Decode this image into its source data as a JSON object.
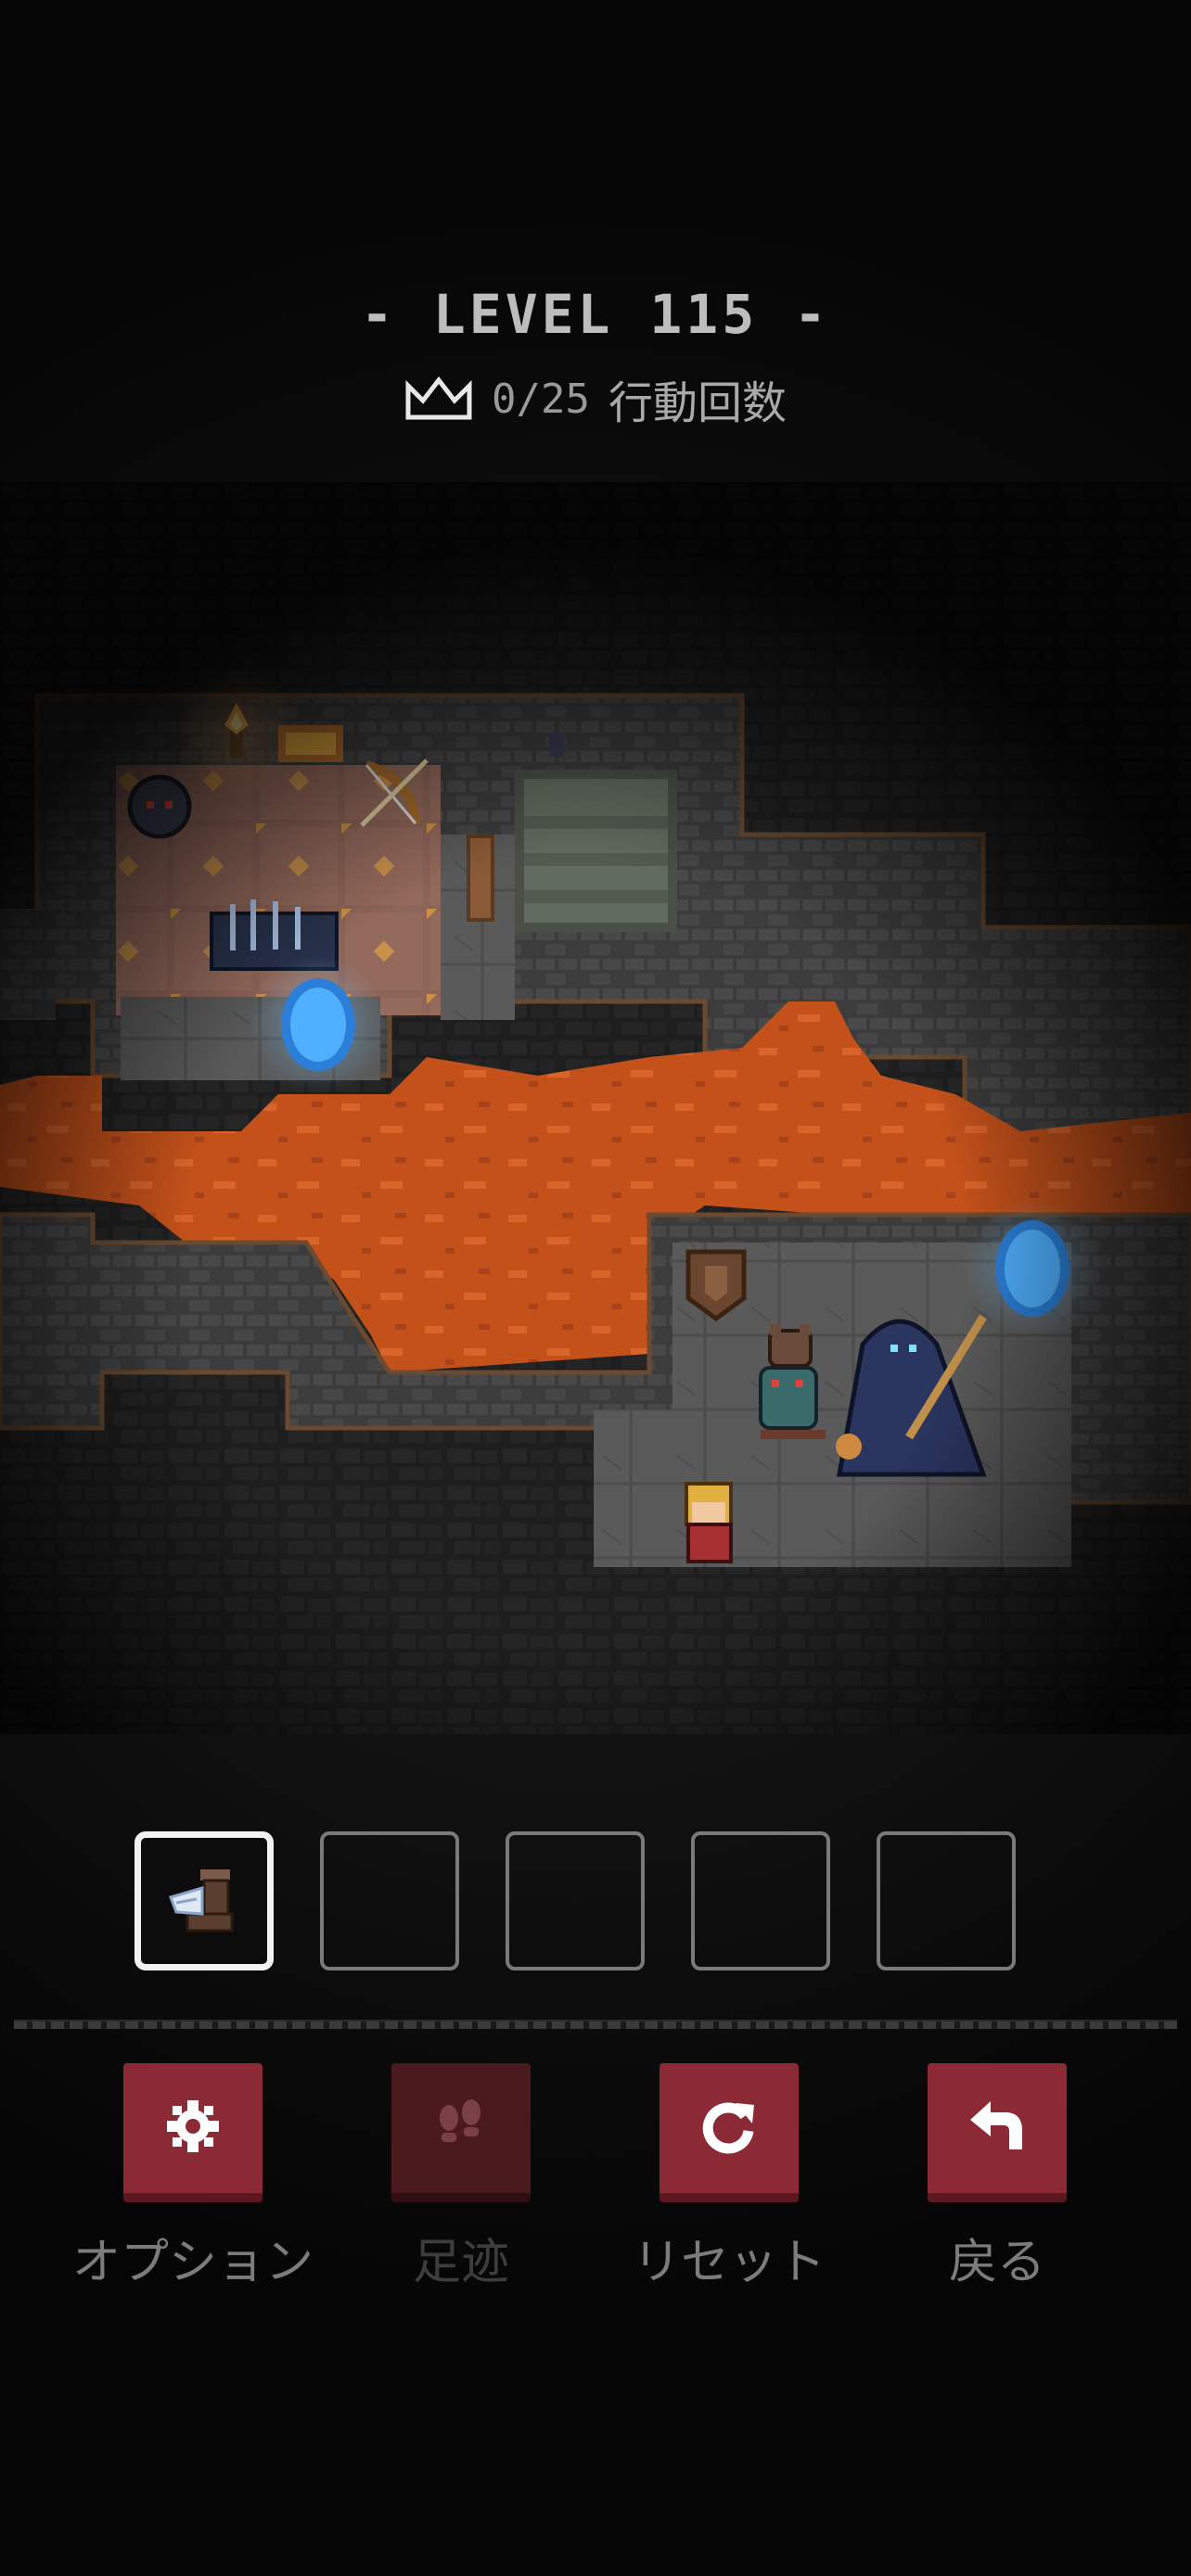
{
  "header": {
    "level_title": "- LEVEL 115 -",
    "moves_count": "0/25",
    "moves_label": "行動回数"
  },
  "inventory": {
    "selected_index": 0,
    "slots": [
      {
        "item": "winged-boots-icon",
        "empty": false
      },
      {
        "item": "",
        "empty": true
      },
      {
        "item": "",
        "empty": true
      },
      {
        "item": "",
        "empty": true
      },
      {
        "item": "",
        "empty": true
      }
    ]
  },
  "controls": {
    "options_label": "オプション",
    "footprints_label": "足迹",
    "reset_label": "リセット",
    "back_label": "戻る"
  },
  "colors": {
    "button": "#8b2a35",
    "button_disabled": "#4a1a1f",
    "lava": "#c8551c",
    "stone_floor": "#5e5e5e",
    "wall": "#3a3a3a",
    "portal": "#3aa0ff"
  }
}
